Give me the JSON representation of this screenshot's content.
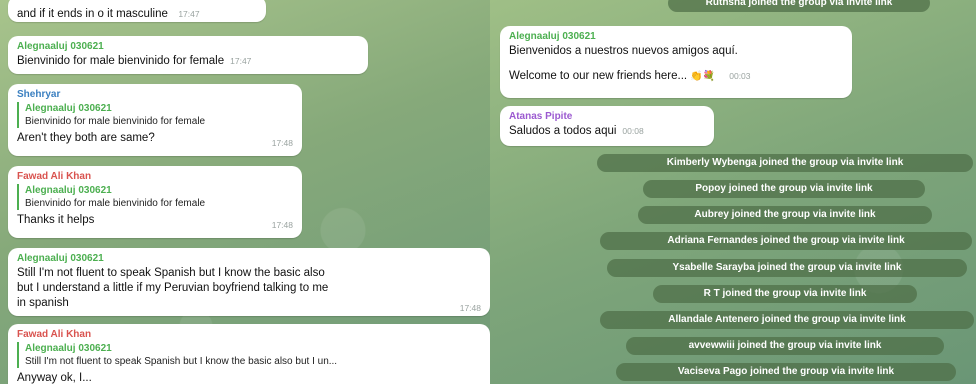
{
  "left_chat": {
    "messages": [
      {
        "text": "and if it ends in o it masculine",
        "time": "17:47"
      },
      {
        "sender": "Alegnaaluj 030621",
        "text": "Bienvinido for male bienvinido for female",
        "time": "17:47"
      },
      {
        "sender": "Shehryar",
        "reply_name": "Alegnaaluj 030621",
        "reply_text": "Bienvinido for male bienvinido for female",
        "text": "Aren't they both are same?",
        "time": "17:48"
      },
      {
        "sender": "Fawad Ali Khan",
        "reply_name": "Alegnaaluj 030621",
        "reply_text": "Bienvinido for male bienvinido for female",
        "text": "Thanks it helps",
        "time": "17:48"
      },
      {
        "sender": "Alegnaaluj 030621",
        "text_lines": [
          "Still I'm not fluent to speak Spanish but I know the basic also",
          "but I understand   a little if my Peruvian boyfriend talking to me",
          "in spanish"
        ],
        "time": "17:48"
      },
      {
        "sender": "Fawad Ali Khan",
        "reply_name": "Alegnaaluj 030621",
        "reply_text": "Still I'm not fluent to speak Spanish but I know the basic also but I un...",
        "text": "Anyway ok, I..."
      }
    ]
  },
  "right_chat": {
    "top_pill": "Ruthsna joined the group via invite link",
    "messages": [
      {
        "sender": "Alegnaaluj 030621",
        "line1": "Bienvenidos a nuestros nuevos amigos aquí.",
        "line2": "Welcome to our new friends here...",
        "emoji": "👏💐",
        "time": "00:03"
      },
      {
        "sender": "Atanas Pipite",
        "text": "Saludos  a todos aqui",
        "time": "00:08"
      }
    ],
    "joins": [
      "Kimberly Wybenga joined the group via invite link",
      "Popoy joined the group via invite link",
      "Aubrey joined the group via invite link",
      "Adriana Fernandes joined the group via invite link",
      "Ysabelle Sarayba joined the group via invite link",
      "R T joined the group via invite link",
      "Allandale Antenero joined the group via invite link",
      "avvewwiii joined the group via invite link",
      "Vaciseva Pago joined the group via invite link"
    ]
  },
  "colors": {
    "sender_green": "#4caf50",
    "sender_blue": "#3a7fc0",
    "sender_red": "#d9534f",
    "sender_purple": "#9b59d0"
  }
}
